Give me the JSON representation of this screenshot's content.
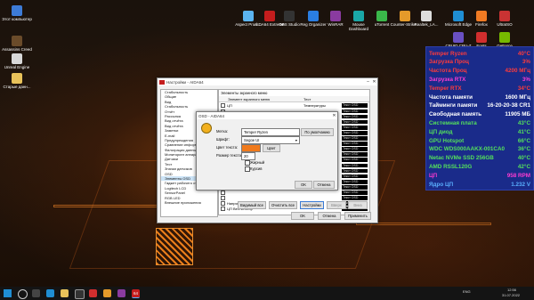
{
  "desktop_icons": [
    {
      "label": "Этот компьютер",
      "color": "#3d7bd6"
    },
    {
      "label": "Assassins Creed ...",
      "color": "#6a4b2a"
    },
    {
      "label": "Unreal Engine",
      "color": "#d8d8d8"
    },
    {
      "label": "Старые данн...",
      "color": "#e8c25a"
    },
    {
      "label": "Aspect Prod ...",
      "color": "#5bb4f0"
    },
    {
      "label": "AIDA64 Extreme",
      "color": "#c41d1d"
    },
    {
      "label": "OBS Studio",
      "color": "#333333"
    },
    {
      "label": "Reg Organizer",
      "color": "#2a7de1"
    },
    {
      "label": "WinRAR",
      "color": "#8a3ba0"
    },
    {
      "label": "Mouse Dashboard",
      "color": "#1aa7a7"
    },
    {
      "label": "uTorrent",
      "color": "#3ab74a"
    },
    {
      "label": "Counter-Strike...",
      "color": "#e59a2a"
    },
    {
      "label": "Realtek_LA...",
      "color": "#dddddd"
    },
    {
      "label": "Microsoft Edge",
      "color": "#1f8ed4"
    },
    {
      "label": "Firefox",
      "color": "#f07a23"
    },
    {
      "label": "UltraISO",
      "color": "#c93333"
    },
    {
      "label": "CPUID CPU-Z",
      "color": "#6a50c2"
    },
    {
      "label": "Fonts PhotoshPDF",
      "color": "#d12e2e"
    },
    {
      "label": "GeForce Experience",
      "color": "#76b900"
    }
  ],
  "overlay": {
    "rows": [
      {
        "label": "Temper Ryzen",
        "value": "40°C",
        "color": "#ff3b3b"
      },
      {
        "label": "Загрузка Проц",
        "value": "3%",
        "color": "#ff3b3b"
      },
      {
        "label": "Частота Проц",
        "value": "4200 МГц",
        "color": "#ff3b3b"
      },
      {
        "label": "Загрузка RTX",
        "value": "3%",
        "color": "#ff3bd1"
      },
      {
        "label": "Temper RTX",
        "value": "34°C",
        "color": "#ff3b3b"
      },
      {
        "label": "Частота памяти",
        "value": "1600 МГц",
        "color": "#ffffff"
      },
      {
        "label": "Тайминги памяти",
        "value": "16-20-20-38 CR1",
        "color": "#ffffff"
      },
      {
        "label": "Свободная память",
        "value": "11905 МБ",
        "color": "#ffffff"
      },
      {
        "label": "Системная плата",
        "value": "43°C",
        "color": "#54e05c"
      },
      {
        "label": "ЦП диод",
        "value": "41°C",
        "color": "#54e05c"
      },
      {
        "label": "GPU Hotspot",
        "value": "66°C",
        "color": "#54e05c"
      },
      {
        "label": "WDC WDS000AAKX-001CA0",
        "value": "36°C",
        "color": "#54e05c"
      },
      {
        "label": "Netac NVMe SSD 256GB",
        "value": "40°C",
        "color": "#54e05c"
      },
      {
        "label": "AMD RSSL120G",
        "value": "42°C",
        "color": "#54e05c"
      },
      {
        "label": "ЦП",
        "value": "958 RPM",
        "color": "#ff3bd1"
      },
      {
        "label": "Ядро ЦП",
        "value": "1.232 V",
        "color": "#5ab0ff"
      }
    ]
  },
  "settings_window": {
    "title": "Настройки - AIDA64",
    "tree": [
      "Стабильность",
      "Общие",
      "Вид",
      "Стабильность",
      "Отчёт",
      "Рассылка",
      "Вид отчёта",
      "Вид отчёта",
      "Заметки",
      "E-mail",
      "Предупреждения",
      "Сравнение информации",
      "Фильтрация данных",
      "Мониторинг аппаратуры",
      "Датчики",
      "Тест",
      "Значки датчиков",
      "OSD",
      "Элементы OSD",
      "Гаджет рабочего стола",
      "Logitech LCD",
      "SensorPanel",
      "RGB LED",
      "Внешние приложения"
    ],
    "panel_title": "Элементы экранного меню",
    "header_left": "Элемент экранного меню",
    "header_right": "Тест",
    "list": [
      {
        "text": "ЦП",
        "right": "Температуры",
        "sample": "Текст OSD"
      },
      {
        "text": "",
        "right": "",
        "sample": "Текст OSD"
      },
      {
        "text": "",
        "right": "",
        "sample": "Текст OSD"
      },
      {
        "text": "",
        "right": "",
        "sample": "Текст OSD"
      },
      {
        "text": "",
        "right": "",
        "sample": "Текст OSD"
      },
      {
        "text": "",
        "right": "",
        "sample": "Текст OSD"
      },
      {
        "text": "",
        "right": "",
        "sample": "Текст OSD"
      },
      {
        "text": "",
        "right": "",
        "sample": "Текст OSD"
      },
      {
        "text": "",
        "right": "",
        "sample": "Текст OSD"
      },
      {
        "text": "",
        "right": "",
        "sample": "Текст OSD"
      },
      {
        "text": "",
        "right": "",
        "sample": "Текст OSD"
      },
      {
        "text": "",
        "right": "",
        "sample": "Текст OSD"
      },
      {
        "text": "",
        "right": "",
        "sample": "Текст OSD"
      },
      {
        "text": "",
        "right": "",
        "sample": "Текст OSD"
      },
      {
        "text": "",
        "right": "",
        "sample": "Текст OSD"
      },
      {
        "text": "",
        "right": "",
        "sample": "Текст OSD"
      },
      {
        "text": "",
        "right": "",
        "sample": "Текст OSD"
      },
      {
        "text": "",
        "right": "",
        "sample": "Текст OSD"
      },
      {
        "text": "Напряжение ЦП",
        "right": "",
        "sample": "Текст OSD"
      },
      {
        "text": "ЦП Вентилятор",
        "right": "",
        "sample": "Текст OSD"
      }
    ],
    "buttons": {
      "visible_all": "Видимый все",
      "hide_all": "Очистить все",
      "settings": "Настройки",
      "up": "Вверх",
      "down": "Вниз",
      "ok": "OK",
      "cancel": "Отмена",
      "apply": "Применить"
    }
  },
  "osd_dialog": {
    "title": "OSD - AIDA64",
    "label_label": "Метка:",
    "label_value": "Temper Ryzen",
    "default_btn": "По умолчанию",
    "font_label": "Шрифт:",
    "font_value": "Segoe UI",
    "color_label": "Цвет текста:",
    "color_btn": "Цвет",
    "text_color": "#f07a1c",
    "size_label": "Размер текста:",
    "size_value": "20",
    "bold_label": "Жирный",
    "italic_label": "Курсив",
    "ok": "OK",
    "cancel": "Отмена"
  },
  "taskbar": {
    "search_badge": "64",
    "tray_text": "ENG",
    "time": "12:56",
    "date": "31.07.2022"
  }
}
